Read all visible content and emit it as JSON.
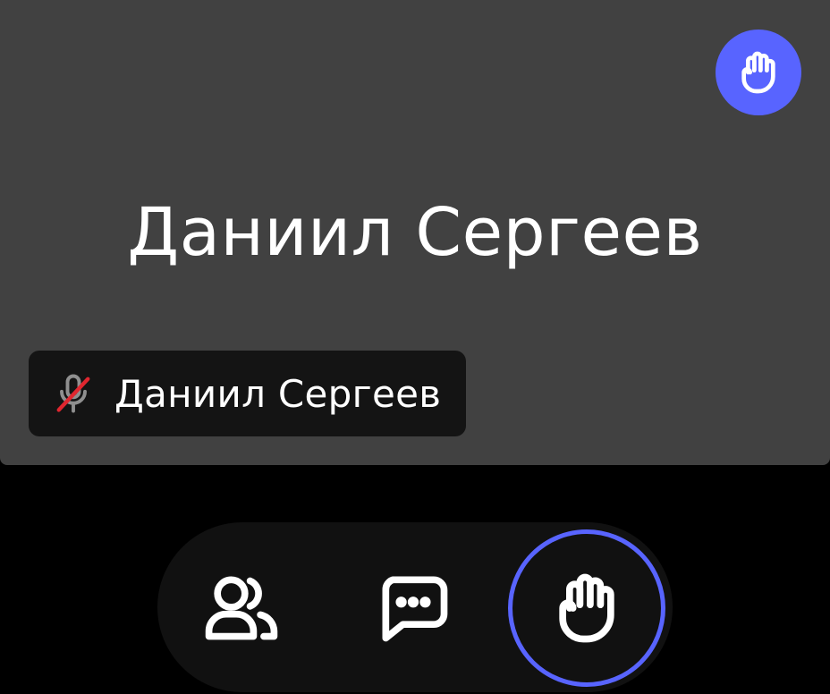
{
  "participant": {
    "display_name": "Даниил Сергеев",
    "label_name": "Даниил Сергеев",
    "mic_icon": "mic-muted-icon",
    "hand_raised_icon": "raised-hand-icon"
  },
  "toolbar": {
    "buttons": [
      {
        "id": "participants",
        "icon": "people-icon"
      },
      {
        "id": "chat",
        "icon": "chat-bubble-icon"
      },
      {
        "id": "raise-hand",
        "icon": "raised-hand-icon",
        "active": true
      }
    ]
  },
  "colors": {
    "tile_background": "#414141",
    "accent": "#5864ff",
    "mute_slash": "#e0262f",
    "toolbar_background": "#111111",
    "page_background": "#000000",
    "text": "#ffffff"
  }
}
